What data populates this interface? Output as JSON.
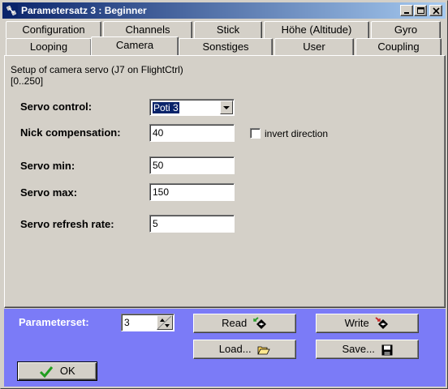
{
  "window": {
    "title": "Parametersatz 3 : Beginner"
  },
  "tabs": {
    "row1": [
      "Configuration",
      "Channels",
      "Stick",
      "Höhe (Altitude)",
      "Gyro"
    ],
    "row2": [
      "Looping",
      "Camera",
      "Sonstiges",
      "User",
      "Coupling"
    ],
    "active": "Camera"
  },
  "camera": {
    "description_line1": "Setup of camera servo (J7 on FlightCtrl)",
    "description_line2": "[0..250]",
    "servo_control": {
      "label": "Servo control:",
      "value": "Poti 3"
    },
    "nick_compensation": {
      "label": "Nick compensation:",
      "value": "40"
    },
    "invert_direction": {
      "label": "invert direction",
      "checked": false
    },
    "servo_min": {
      "label": "Servo min:",
      "value": "50"
    },
    "servo_max": {
      "label": "Servo max:",
      "value": "150"
    },
    "servo_refresh_rate": {
      "label": "Servo refresh rate:",
      "value": "5"
    }
  },
  "footer": {
    "parameterset_label": "Parameterset:",
    "parameterset_value": "3",
    "read_label": "Read",
    "write_label": "Write",
    "load_label": "Load...",
    "save_label": "Save...",
    "ok_label": "OK"
  },
  "colors": {
    "footer_background": "#7b7bf7",
    "titlebar_start": "#0a246a",
    "titlebar_end": "#a6caf0"
  }
}
